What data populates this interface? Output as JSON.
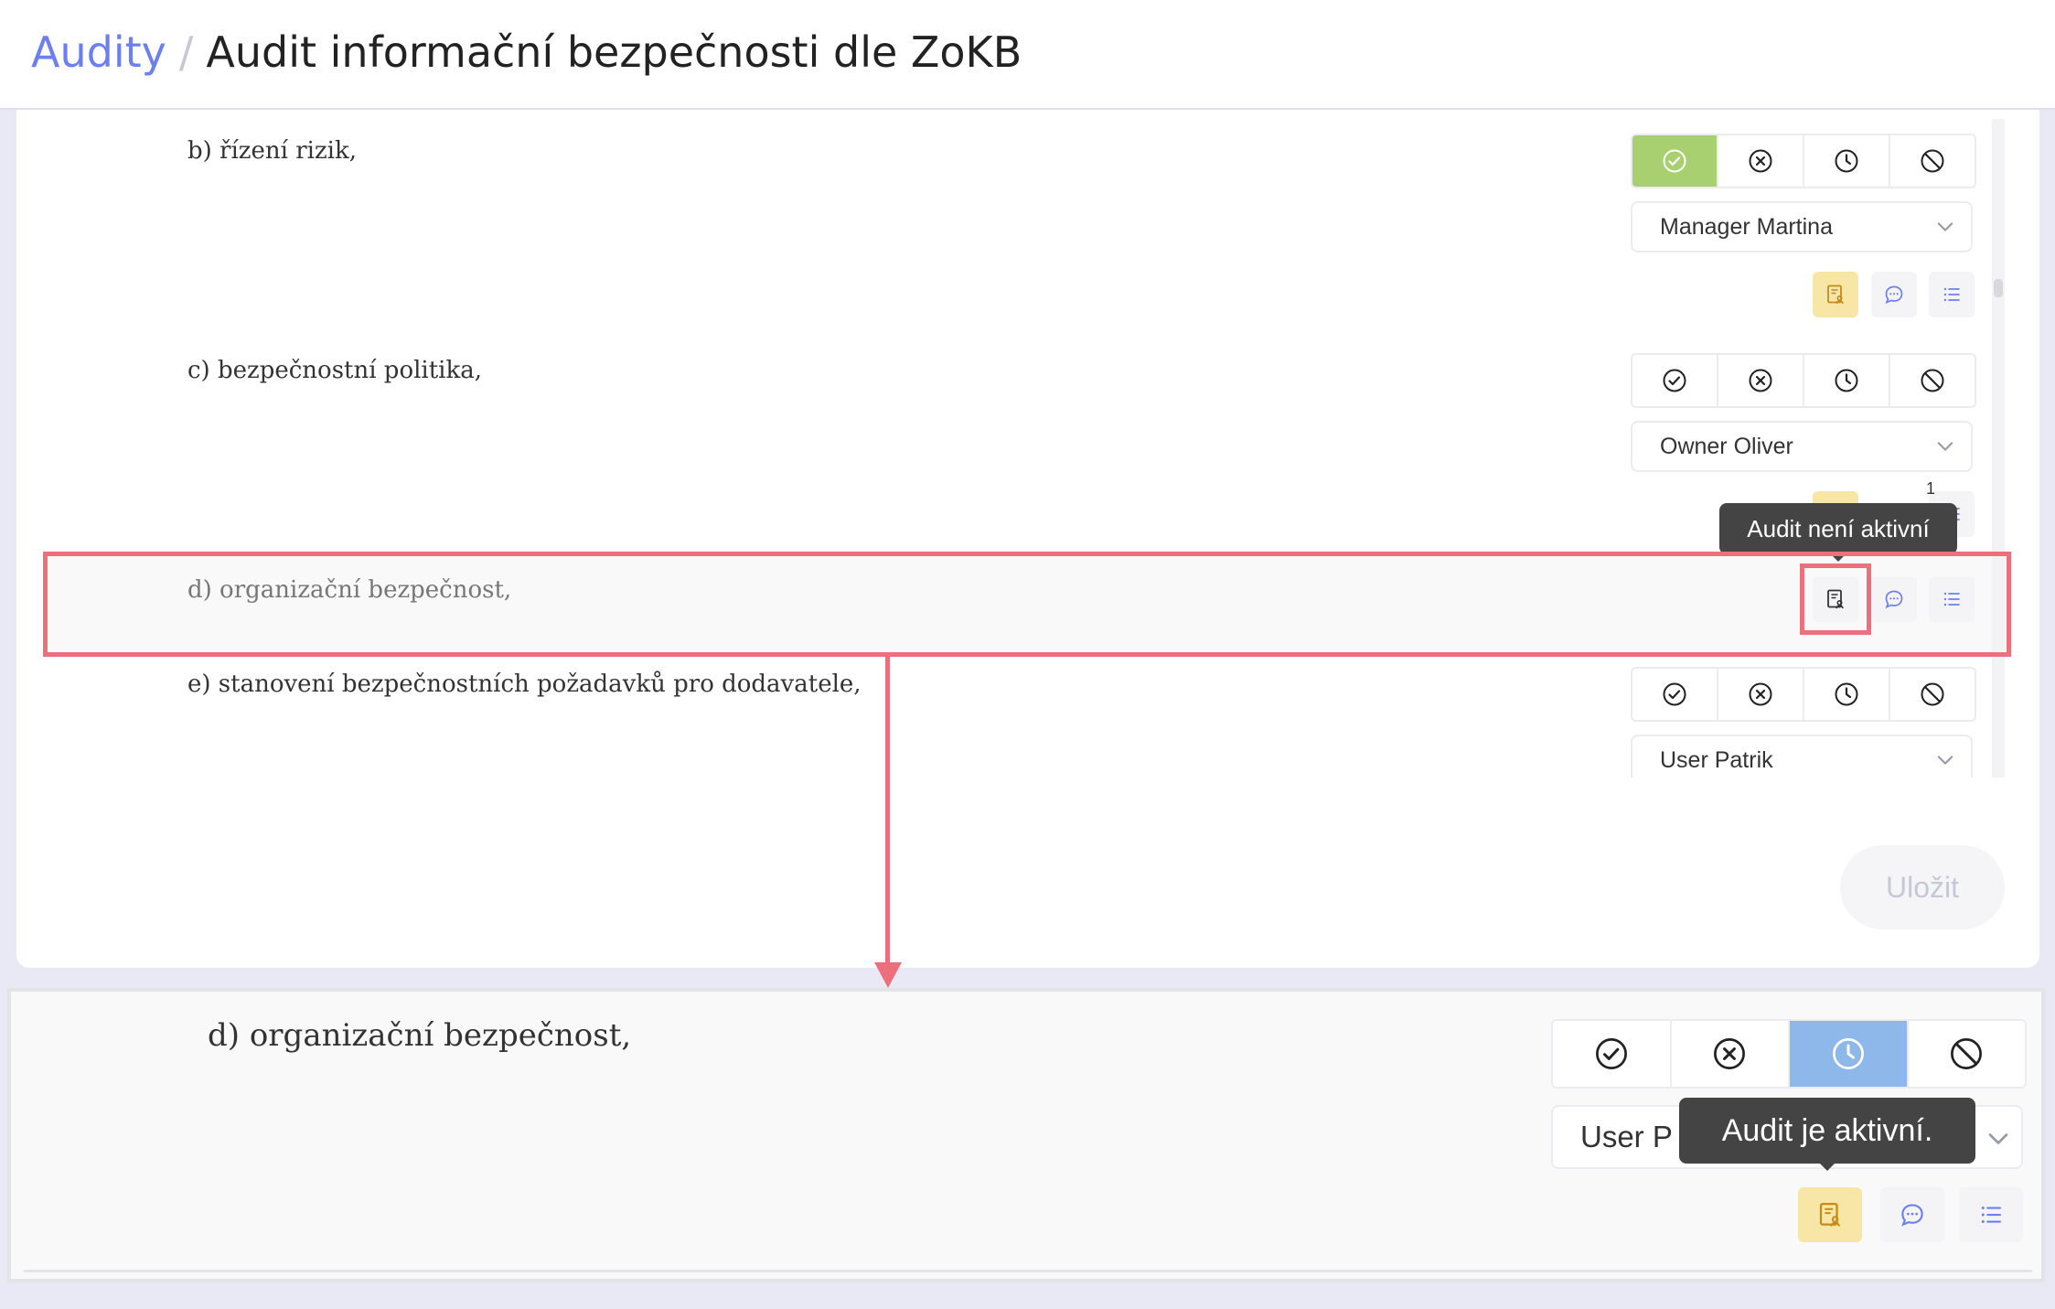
{
  "header": {
    "breadcrumb_parent": "Audity",
    "breadcrumb_separator": "/",
    "page_title": "Audit informační bezpečnosti dle ZoKB"
  },
  "items": [
    {
      "text": "b) řízení rizik,",
      "assignee": "Manager Martina",
      "status": "ok"
    },
    {
      "text": "c) bezpečnostní politika,",
      "assignee": "Owner Oliver",
      "status": "none",
      "badge": "1"
    },
    {
      "text": "d) organizační bezpečnost,",
      "tooltip": "Audit není aktivní"
    },
    {
      "text": "e) stanovení bezpečnostních požadavků pro dodavatele,",
      "assignee": "User Patrik",
      "status": "none"
    }
  ],
  "save_label": "Uložit",
  "zoom": {
    "text": "d) organizační bezpečnost,",
    "assignee_partial": "User P",
    "status": "waiting",
    "tooltip": "Audit je aktivní."
  },
  "colors": {
    "accent": "#6c7ff0",
    "ok_active": "#a8d070",
    "wait_active": "#8fb8ea",
    "audit_icon_bg": "#f7e6a6",
    "annotation": "#ee6f7c"
  },
  "icons": [
    "check-circle-icon",
    "x-circle-icon",
    "clock-icon",
    "ban-icon",
    "chevron-down-icon",
    "audit-document-icon",
    "comment-icon",
    "list-icon"
  ]
}
